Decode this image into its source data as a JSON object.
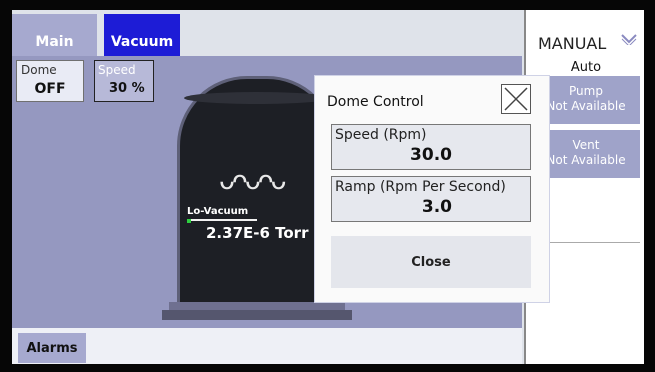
{
  "tabs": [
    {
      "label": "Main"
    },
    {
      "label": "Vacuum"
    }
  ],
  "dome": {
    "label": "Dome",
    "value": "OFF"
  },
  "speed": {
    "label": "Speed",
    "value": "30 %"
  },
  "lo_vacuum": {
    "label": "Lo-Vacuum",
    "value": "2.37E-6 Torr"
  },
  "alarms": {
    "label": "Alarms"
  },
  "mode_select": {
    "selected": "MANUAL",
    "option_auto": "Auto"
  },
  "pump_button": {
    "title": "Pump",
    "status": "Not Available"
  },
  "vent_button": {
    "title": "Vent",
    "status": "Not Available"
  },
  "dialog": {
    "title": "Dome Control",
    "speed_field": {
      "label": "Speed (Rpm)",
      "value": "30.0"
    },
    "ramp_field": {
      "label": "Ramp (Rpm Per Second)",
      "value": "3.0"
    },
    "close_label": "Close"
  },
  "colors": {
    "tab_active": "#1d1cd6",
    "tab_inactive": "#a6a9cf",
    "panel_bg": "#9598c0",
    "status_indicator": "#2ed040"
  },
  "icons": [
    "chevron-down-icon",
    "close-x-icon",
    "heater-coil-icon"
  ]
}
